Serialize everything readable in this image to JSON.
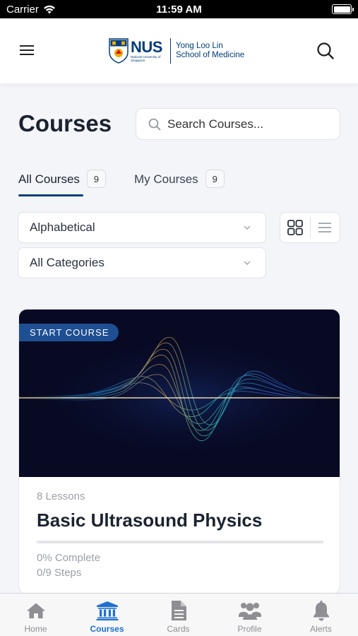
{
  "status_bar": {
    "carrier": "Carrier",
    "time": "11:59 AM"
  },
  "header": {
    "logo_title": "NUS",
    "logo_subtitle": "National University of Singapore",
    "school_line1": "Yong Loo Lin",
    "school_line2": "School of Medicine"
  },
  "page": {
    "title": "Courses",
    "search_placeholder": "Search Courses..."
  },
  "tabs": [
    {
      "label": "All Courses",
      "count": "9",
      "active": true
    },
    {
      "label": "My Courses",
      "count": "9",
      "active": false
    }
  ],
  "filters": {
    "sort_selected": "Alphabetical",
    "category_selected": "All Categories",
    "view_mode": "grid"
  },
  "course": {
    "badge": "START COURSE",
    "lessons": "8 Lessons",
    "title": "Basic Ultrasound Physics",
    "progress_fraction": 0,
    "complete_text": "0% Complete",
    "steps_text": "0/9 Steps"
  },
  "bottom_nav": [
    {
      "label": "Home",
      "icon": "home-icon",
      "active": false
    },
    {
      "label": "Courses",
      "icon": "courses-icon",
      "active": true
    },
    {
      "label": "Cards",
      "icon": "cards-icon",
      "active": false
    },
    {
      "label": "Profile",
      "icon": "profile-icon",
      "active": false
    },
    {
      "label": "Alerts",
      "icon": "bell-icon",
      "active": false
    }
  ],
  "colors": {
    "brand_navy": "#003d7c",
    "badge_blue": "#1f4f93",
    "active_tab_blue": "#1f6fcf",
    "inactive_gray": "#8e8e93"
  }
}
